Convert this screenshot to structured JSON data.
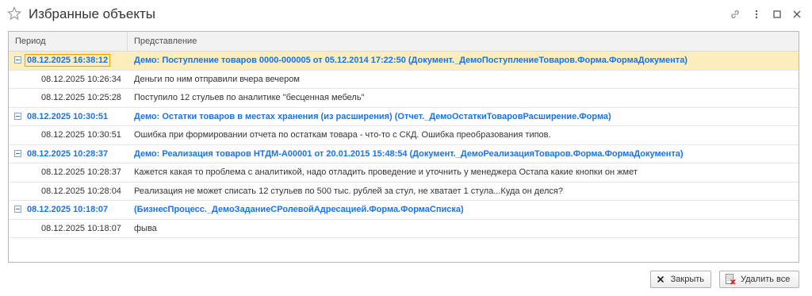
{
  "window": {
    "title": "Избранные объекты"
  },
  "grid": {
    "columns": [
      "Период",
      "Представление"
    ],
    "rows": [
      {
        "type": "group",
        "period": "08.12.2025 16:38:12",
        "text": "Демо: Поступление товаров 0000-000005 от 05.12.2014 17:22:50 (Документ._ДемоПоступлениеТоваров.Форма.ФормаДокумента)",
        "selected": true
      },
      {
        "type": "child",
        "period": "08.12.2025 10:26:34",
        "text": "Деньги по ним отправили вчера вечером"
      },
      {
        "type": "child",
        "period": "08.12.2025 10:25:28",
        "text": "Поступило 12 стульев по аналитике \"бесценная мебель\""
      },
      {
        "type": "group",
        "period": "08.12.2025 10:30:51",
        "text": "Демо: Остатки товаров в местах хранения (из расширения) (Отчет._ДемоОстаткиТоваровРасширение.Форма)"
      },
      {
        "type": "child",
        "period": "08.12.2025 10:30:51",
        "text": "Ошибка при формировании отчета по остаткам товара - что-то с СКД. Ошибка преобразования типов."
      },
      {
        "type": "group",
        "period": "08.12.2025 10:28:37",
        "text": "Демо: Реализация товаров НТДМ-А00001 от 20.01.2015 15:48:54 (Документ._ДемоРеализацияТоваров.Форма.ФормаДокумента)"
      },
      {
        "type": "child",
        "period": "08.12.2025 10:28:37",
        "text": "Кажется какая то проблема с аналитикой, надо отладить проведение и уточнить у менеджера Остапа какие кнопки он жмет"
      },
      {
        "type": "child",
        "period": "08.12.2025 10:28:04",
        "text": "Реализация не может списать 12 стульев по 500 тыс. рублей за стул, не хватает 1 стула...Куда он делся?"
      },
      {
        "type": "group",
        "period": "08.12.2025 10:18:07",
        "text": " (БизнесПроцесс._ДемоЗаданиеСРолевойАдресацией.Форма.ФормаСписка)"
      },
      {
        "type": "child",
        "period": "08.12.2025 10:18:07",
        "text": "фыва"
      }
    ]
  },
  "buttons": {
    "close_label": "Закрыть",
    "delete_all_label": "Удалить все"
  },
  "colors": {
    "accent_text": "#1a73e8",
    "selection": "#fbeebc",
    "focus_border": "#f0a000"
  }
}
